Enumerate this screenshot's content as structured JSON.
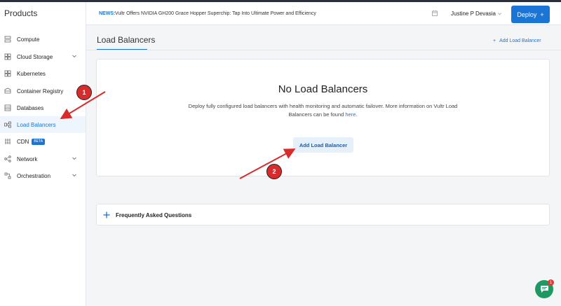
{
  "sidebar": {
    "title": "Products",
    "items": [
      {
        "label": "Compute",
        "icon": "compute-icon"
      },
      {
        "label": "Cloud Storage",
        "icon": "storage-icon"
      },
      {
        "label": "Kubernetes",
        "icon": "kubernetes-icon"
      },
      {
        "label": "Container Registry",
        "icon": "registry-icon"
      },
      {
        "label": "Databases",
        "icon": "database-icon"
      },
      {
        "label": "Load Balancers",
        "icon": "load-balancer-icon"
      },
      {
        "label": "CDN",
        "icon": "cdn-icon",
        "badge": "BETA"
      },
      {
        "label": "Network",
        "icon": "network-icon"
      },
      {
        "label": "Orchestration",
        "icon": "orchestration-icon"
      }
    ]
  },
  "header": {
    "news_tag": "NEWS:",
    "news_text": "Vultr Offers NVIDIA GH200 Grace Hopper Superchip: Tap Into Ultimate Power and Efficiency",
    "user_name": "Justine P Devasia",
    "deploy_label": "Deploy",
    "deploy_plus": "+"
  },
  "main": {
    "tab_label": "Load Balancers",
    "add_link": "Add Load Balancer",
    "empty_title": "No Load Balancers",
    "empty_desc": "Deploy fully configured load balancers with health monitoring and automatic failover. More information on Vultr Load Balancers can be found",
    "empty_link": "here",
    "empty_period": ".",
    "add_button": "Add Load Balancer",
    "faq_label": "Frequently Asked Questions"
  },
  "annotations": {
    "step1": "1",
    "step2": "2"
  },
  "chat": {
    "notification_count": "1"
  },
  "colors": {
    "accent": "#1a75d6",
    "annotation": "#d92b2b",
    "chat": "#1d9a63"
  }
}
